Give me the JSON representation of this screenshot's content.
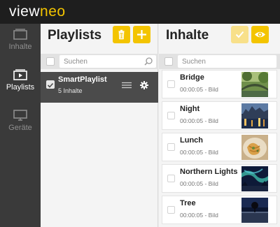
{
  "app": {
    "logo_main": "view",
    "logo_accent": "neo"
  },
  "nav": [
    {
      "label": "Inhalte",
      "icon": "folder-icon"
    },
    {
      "label": "Playlists",
      "icon": "playlist-icon",
      "active": true
    },
    {
      "label": "Geräte",
      "icon": "monitor-icon"
    }
  ],
  "playlists": {
    "title": "Playlists",
    "search_placeholder": "Suchen",
    "items": [
      {
        "name": "SmartPlaylist",
        "count": "5 Inhalte"
      }
    ]
  },
  "contents": {
    "title": "Inhalte",
    "search_placeholder": "Suchen",
    "items": [
      {
        "title": "Bridge",
        "meta": "00:00:05 - Bild",
        "thumb": "bridge"
      },
      {
        "title": "Night",
        "meta": "00:00:05 - Bild",
        "thumb": "night"
      },
      {
        "title": "Lunch",
        "meta": "00:00:05 - Bild",
        "thumb": "lunch"
      },
      {
        "title": "Northern Lights",
        "meta": "00:00:05 - Bild",
        "thumb": "aurora"
      },
      {
        "title": "Tree",
        "meta": "00:00:05 - Bild",
        "thumb": "tree"
      }
    ]
  },
  "colors": {
    "accent": "#f3c400",
    "accent_disabled": "#f8e08a",
    "topbar": "#1e1e1e",
    "nav": "#3a3a3a",
    "selected_row": "#4b4b4b"
  }
}
